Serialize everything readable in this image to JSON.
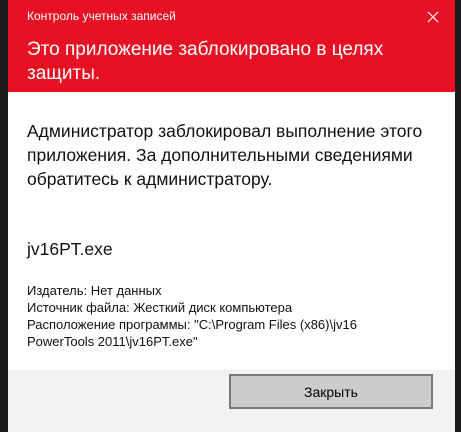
{
  "window": {
    "title": "Контроль учетных записей"
  },
  "header": {
    "text": "Это приложение заблокировано в целях защиты."
  },
  "message": {
    "text": "Администратор заблокировал выполнение этого приложения. За дополнительными сведениями обратитесь к администратору."
  },
  "app": {
    "name": "jv16PT.exe"
  },
  "details": {
    "publisher": "Издатель: Нет данных",
    "source": "Источник файла: Жесткий диск компьютера",
    "location_line1": "Расположение программы: \"C:\\Program Files (x86)\\jv16",
    "location_line2": "PowerTools 2011\\jv16PT.exe\""
  },
  "buttons": {
    "close_label": "Закрыть"
  },
  "colors": {
    "header_red": "#e81123",
    "footer_gray": "#f2f2f2",
    "button_gray": "#cccccc"
  },
  "icons": {
    "close": "close-icon"
  }
}
